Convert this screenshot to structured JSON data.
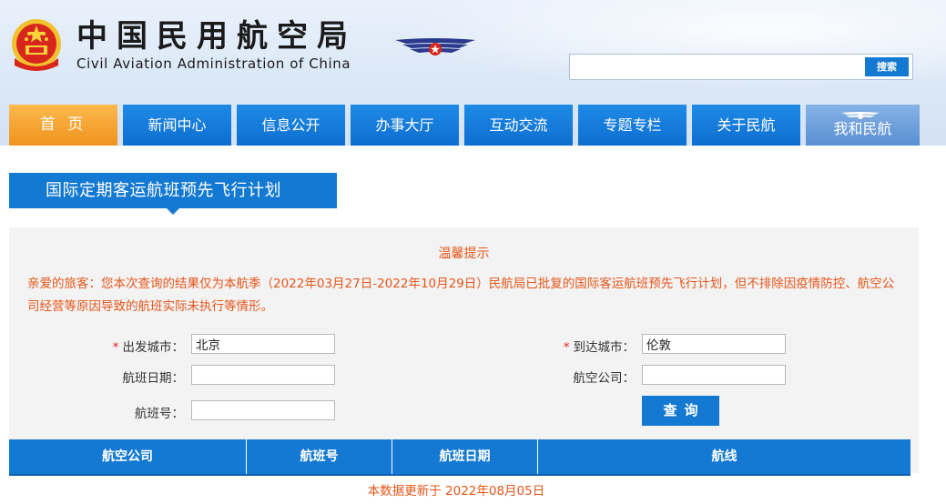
{
  "header": {
    "title_cn": "中国民用航空局",
    "title_en": "Civil Aviation Administration of China",
    "search_placeholder": "",
    "search_button": "搜索"
  },
  "nav": {
    "items": [
      {
        "label": "首 页",
        "active": true
      },
      {
        "label": "新闻中心"
      },
      {
        "label": "信息公开"
      },
      {
        "label": "办事大厅"
      },
      {
        "label": "互动交流"
      },
      {
        "label": "专题专栏"
      },
      {
        "label": "关于民航"
      },
      {
        "label": "我和民航"
      }
    ]
  },
  "section": {
    "title": "国际定期客运航班预先飞行计划"
  },
  "notice": {
    "title": "温馨提示",
    "text": "亲爱的旅客：您本次查询的结果仅为本航季（2022年03月27日-2022年10月29日）民航局已批复的国际客运航班预先飞行计划，但不排除因疫情防控、航空公司经营等原因导致的航班实际未执行等情形。"
  },
  "form": {
    "required_mark": "*",
    "departure_label": "出发城市：",
    "departure_value": "北京",
    "arrival_label": "到达城市：",
    "arrival_value": "伦敦",
    "date_label": "航班日期：",
    "date_value": "",
    "airline_label": "航空公司：",
    "airline_value": "",
    "flight_no_label": "航班号：",
    "flight_no_value": "",
    "query_button": "查询"
  },
  "table": {
    "headers": [
      "航空公司",
      "航班号",
      "航班日期",
      "航线"
    ]
  },
  "footer": {
    "update_text": "本数据更新于 2022年08月05日"
  },
  "colors": {
    "primary": "#1479d2",
    "accent_orange": "#f0931e",
    "notice_text": "#e5561a"
  },
  "icons": {
    "emblem": "national-emblem-icon",
    "caac_logo": "caac-wings-icon"
  }
}
